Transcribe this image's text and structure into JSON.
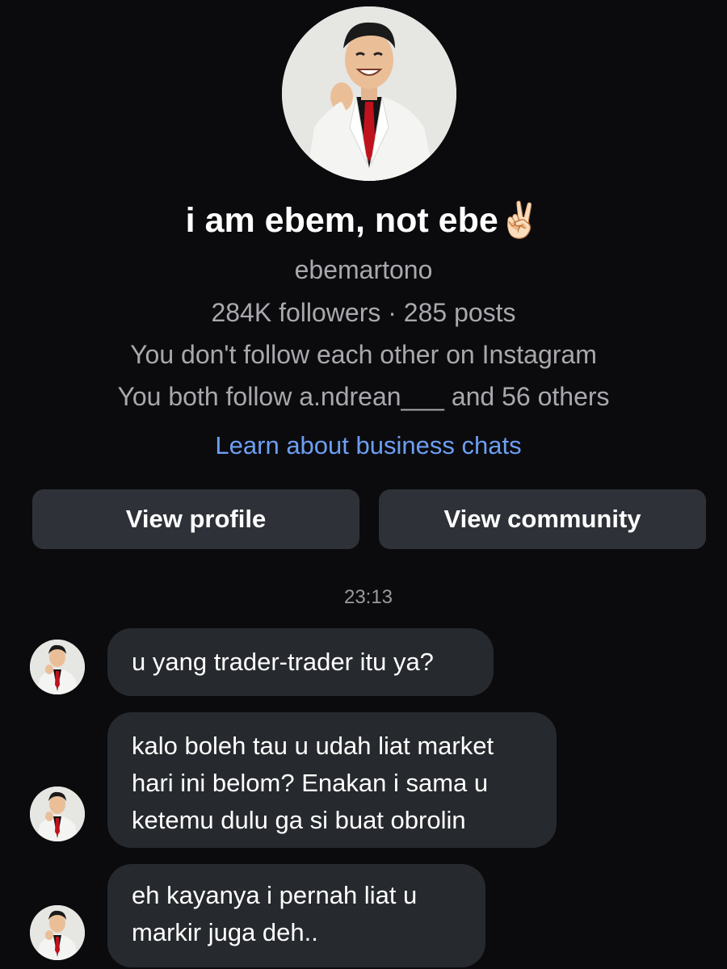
{
  "profile": {
    "display_name": "i am ebem, not ebe✌🏻",
    "username": "ebemartono",
    "stats": "284K followers · 285 posts",
    "follow_status": "You don't follow each other on Instagram",
    "mutual_follow": "You both follow a.ndrean___ and 56 others",
    "learn_link": "Learn about business chats"
  },
  "actions": {
    "view_profile": "View profile",
    "view_community": "View community"
  },
  "chat": {
    "timestamp": "23:13",
    "messages": [
      {
        "lines": [
          "u yang trader-trader itu ya?"
        ]
      },
      {
        "lines": [
          "kalo boleh tau u udah liat market",
          "hari ini belom? Enakan i sama u",
          "ketemu dulu ga si buat obrolin"
        ]
      },
      {
        "lines": [
          "eh kayanya i pernah liat u",
          "markir juga deh.."
        ]
      }
    ]
  },
  "colors": {
    "background": "#0b0b0e",
    "secondary_text": "#a8a8ad",
    "link": "#6d9ff2",
    "button_bg": "#2e3238",
    "bubble_bg": "#26292d",
    "tie": "#c0121d",
    "suit": "#f4f4f2"
  }
}
